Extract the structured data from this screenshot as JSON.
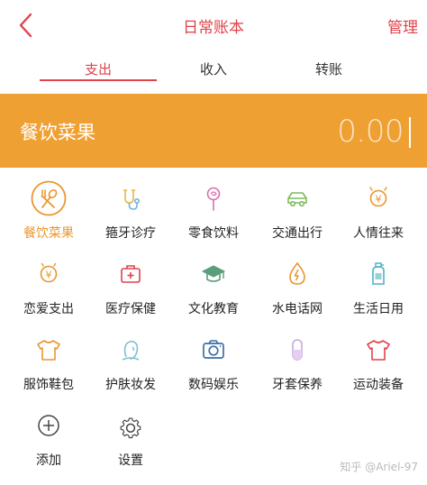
{
  "header": {
    "title": "日常账本",
    "manage_label": "管理"
  },
  "tabs": [
    {
      "label": "支出",
      "active": true
    },
    {
      "label": "收入",
      "active": false
    },
    {
      "label": "转账",
      "active": false
    }
  ],
  "amount_bar": {
    "category": "餐饮菜果",
    "amount": "0.00",
    "color": "#efa033"
  },
  "colors": {
    "accent": "#e0424a",
    "selected": "#e9962e"
  },
  "categories": [
    {
      "label": "餐饮菜果",
      "icon": "fork-spoon-icon"
    },
    {
      "label": "箍牙诊疗",
      "icon": "stethoscope-icon"
    },
    {
      "label": "零食饮料",
      "icon": "lollipop-icon"
    },
    {
      "label": "交通出行",
      "icon": "car-icon"
    },
    {
      "label": "人情往来",
      "icon": "gift-money-icon"
    },
    {
      "label": "恋爱支出",
      "icon": "love-money-icon"
    },
    {
      "label": "医疗保健",
      "icon": "medical-kit-icon"
    },
    {
      "label": "文化教育",
      "icon": "graduation-cap-icon"
    },
    {
      "label": "水电话网",
      "icon": "lightning-drop-icon"
    },
    {
      "label": "生活日用",
      "icon": "bottle-icon"
    },
    {
      "label": "服饰鞋包",
      "icon": "tshirt-icon"
    },
    {
      "label": "护肤妆发",
      "icon": "face-icon"
    },
    {
      "label": "数码娱乐",
      "icon": "camera-icon"
    },
    {
      "label": "牙套保养",
      "icon": "capsule-icon"
    },
    {
      "label": "运动装备",
      "icon": "sport-shirt-icon"
    },
    {
      "label": "添加",
      "icon": "add-circle-icon"
    },
    {
      "label": "设置",
      "icon": "gear-icon"
    }
  ],
  "watermark": "知乎 @Ariel-97"
}
